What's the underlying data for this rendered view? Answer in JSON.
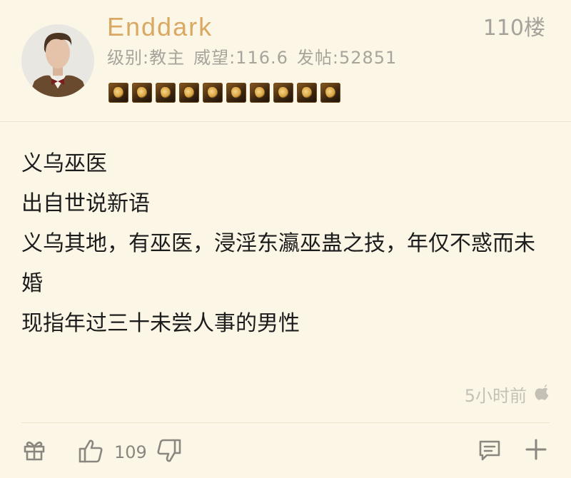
{
  "post": {
    "username": "Enddark",
    "floor": "110楼",
    "user_stats": {
      "level": "级别:教主",
      "prestige": "威望:116.6",
      "posts": "发帖:52851"
    },
    "badges": [
      "badge-1",
      "badge-2",
      "badge-3",
      "badge-4",
      "badge-5",
      "badge-6",
      "badge-7",
      "badge-8",
      "badge-9",
      "badge-10"
    ],
    "content": [
      "义乌巫医",
      "出自世说新语",
      "义乌其地，有巫医，浸淫东瀛巫蛊之技，年仅不惑而未婚",
      "现指年过三十未尝人事的男性"
    ],
    "time": "5小时前",
    "device_icon": "apple-icon"
  },
  "actions": {
    "like_count": "109",
    "icons": [
      "gift-icon",
      "thumbs-up-icon",
      "thumbs-down-icon",
      "comment-icon",
      "plus-icon"
    ]
  },
  "colors": {
    "background": "#fcf6e6",
    "username": "#d9a964",
    "muted": "#a8a49c",
    "text": "#1c1c1c"
  }
}
